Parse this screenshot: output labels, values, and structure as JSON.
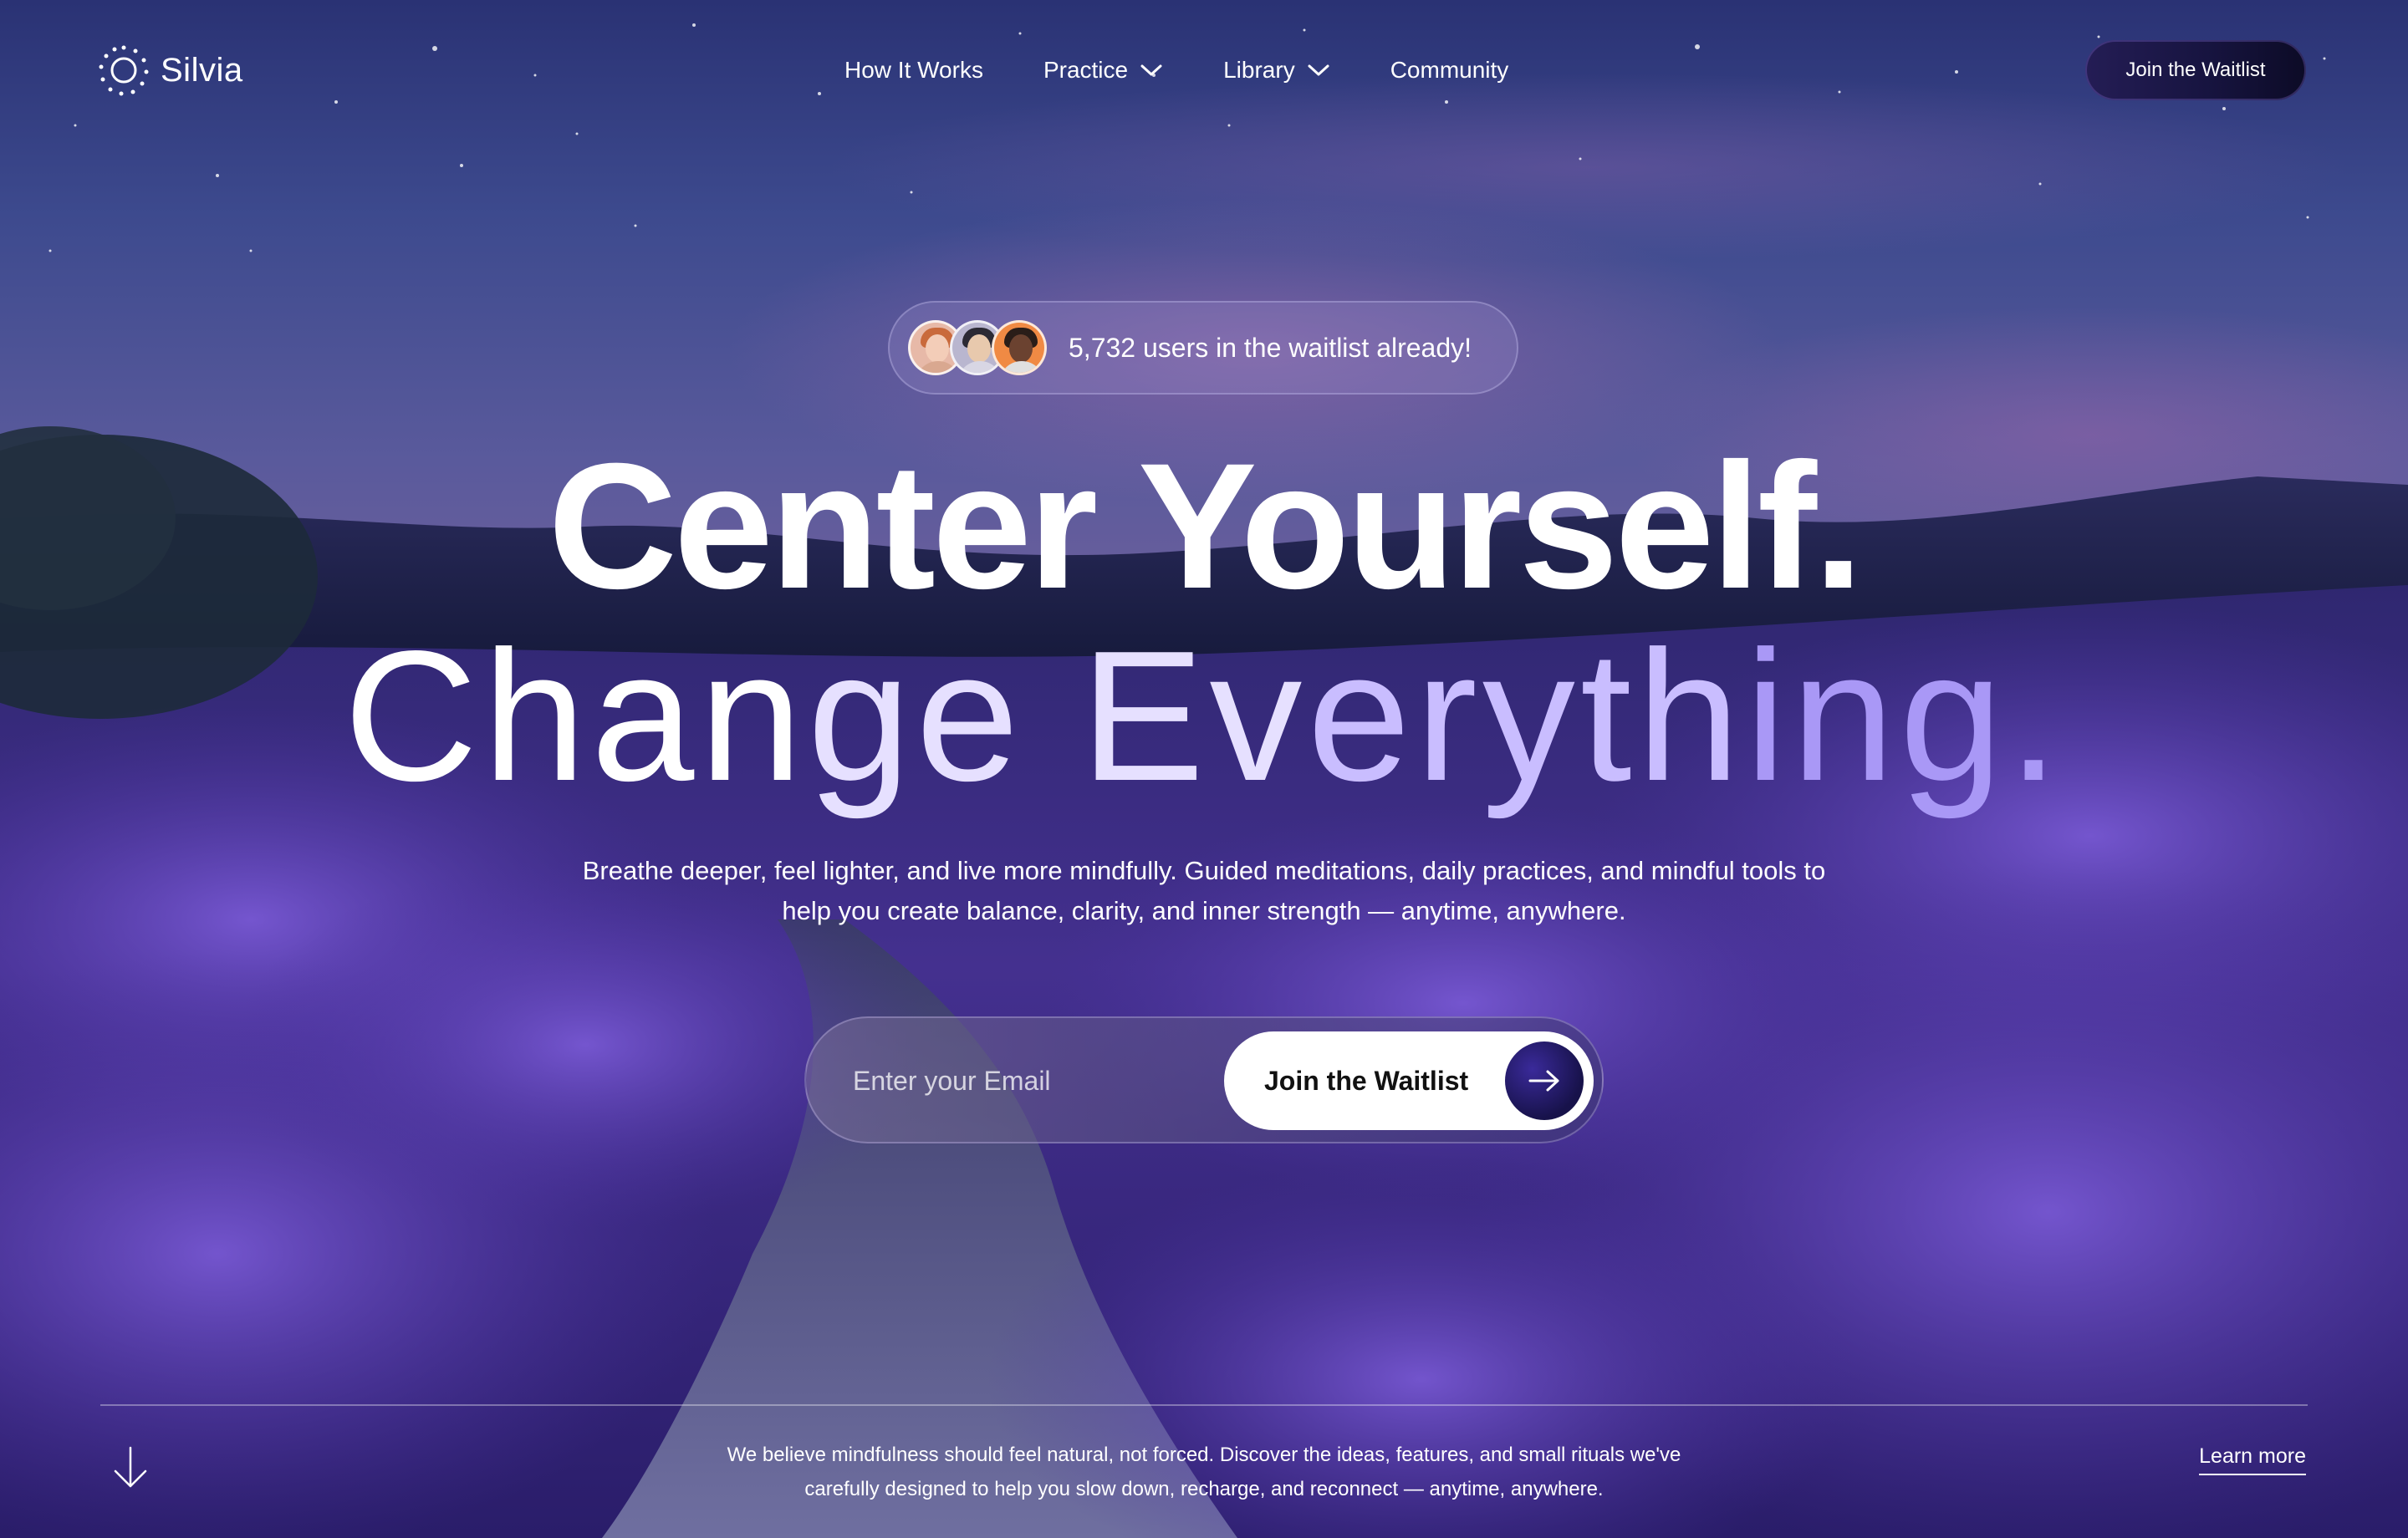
{
  "brand": {
    "name": "Silvia"
  },
  "nav": {
    "items": [
      {
        "label": "How It Works",
        "has_dropdown": false
      },
      {
        "label": "Practice",
        "has_dropdown": true
      },
      {
        "label": "Library",
        "has_dropdown": true
      },
      {
        "label": "Community",
        "has_dropdown": false
      }
    ],
    "cta_label": "Join the Waitlist"
  },
  "waitlist_pill": {
    "text": "5,732 users in the waitlist already!"
  },
  "hero": {
    "headline_line1": "Center Yourself.",
    "headline_line2_parts": [
      "Chan",
      "ge Ev",
      "eryth",
      "ing."
    ],
    "subtitle": "Breathe deeper, feel lighter, and live more mindfully. Guided meditations, daily practices, and mindful tools to help you create balance, clarity, and inner strength — anytime, anywhere."
  },
  "signup": {
    "email_placeholder": "Enter your Email",
    "email_value": "",
    "button_label": "Join the Waitlist"
  },
  "footer": {
    "text": "We believe mindfulness should feel natural, not forced. Discover the ideas, features, and small rituals we've carefully designed to help you slow down, recharge, and reconnect — anytime, anywhere.",
    "learn_more_label": "Learn more"
  },
  "icons": {
    "logo": "sun-ring-icon",
    "dropdown": "chevron-down-icon",
    "submit": "arrow-right-icon",
    "scroll": "arrow-down-icon"
  },
  "colors": {
    "sky_top": "#2a3274",
    "lavender": "#5b3fb5",
    "cta_dark": "#171440",
    "accent_purple": "#a998f6"
  }
}
